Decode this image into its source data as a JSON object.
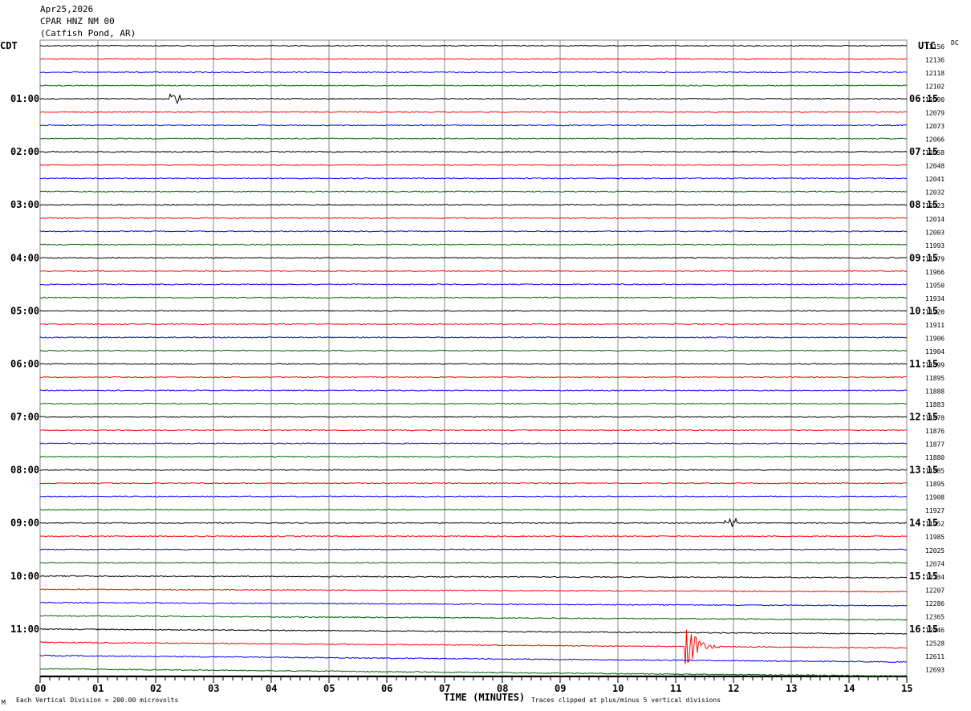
{
  "header": {
    "date": "Apr25,2026",
    "station": "CPAR HNZ NM 00",
    "location": "(Catfish Pond, AR)"
  },
  "left_timezone": "CDT",
  "right_timezone": "UTC",
  "dc_header": "DC",
  "footer": {
    "scale_note": "Each Vertical Division =  200.00 microvolts",
    "clip_note": "Traces clipped at plus/minus 5 vertical divisions",
    "corner_mark": "M"
  },
  "chart_data": {
    "type": "line",
    "title": "",
    "xlabel": "TIME (MINUTES)",
    "xlim": [
      0,
      15
    ],
    "x_ticks": [
      "00",
      "01",
      "02",
      "03",
      "04",
      "05",
      "06",
      "07",
      "08",
      "09",
      "10",
      "11",
      "12",
      "13",
      "14",
      "15"
    ],
    "trace_colors": [
      "#000000",
      "#ff0000",
      "#0000ff",
      "#006400"
    ],
    "left_hour_labels": [
      "01:00",
      "02:00",
      "03:00",
      "04:00",
      "05:00",
      "06:00",
      "07:00",
      "08:00",
      "09:00",
      "10:00",
      "11:00"
    ],
    "right_hour_labels": [
      "06:15",
      "07:15",
      "08:15",
      "09:15",
      "10:15",
      "11:15",
      "12:15",
      "13:15",
      "14:15",
      "15:15",
      "16:15"
    ],
    "dc_values": [
      12156,
      12136,
      12118,
      12102,
      12090,
      12079,
      12073,
      12066,
      12058,
      12048,
      12041,
      12032,
      12023,
      12014,
      12003,
      11993,
      11979,
      11966,
      11950,
      11934,
      11920,
      11911,
      11906,
      11904,
      11899,
      11895,
      11888,
      11883,
      11878,
      11876,
      11877,
      11880,
      11885,
      11895,
      11908,
      11927,
      11952,
      11985,
      12025,
      12074,
      12134,
      12207,
      12286,
      12365,
      12446,
      12528,
      12611,
      12693
    ],
    "events": [
      {
        "trace": 4,
        "minute": 2.3,
        "amplitude": "small"
      },
      {
        "trace": 36,
        "minute": 11.9,
        "amplitude": "small"
      },
      {
        "trace": 45,
        "minute": 11.2,
        "amplitude": "large"
      }
    ]
  }
}
